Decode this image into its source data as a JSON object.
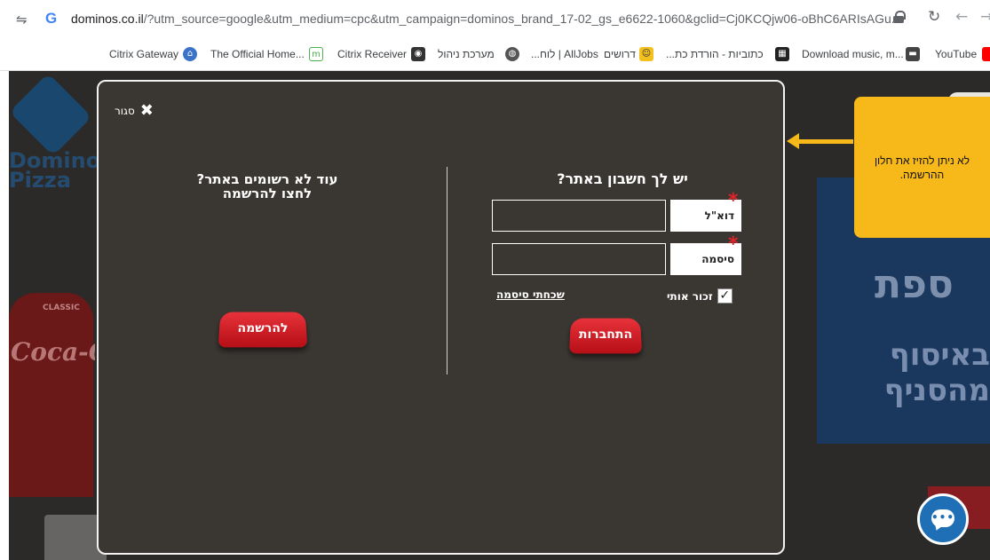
{
  "browser": {
    "url_host": "dominos.co.il",
    "url_rest": "/?utm_source=google&utm_medium=cpc&utm_campaign=dominos_brand_17-02_gs_e6622-1060&gclid=Cj0KCQjw06-oBhC6ARIsAGu...",
    "bookmarks": [
      "Citrix Gateway",
      "The Official Home...",
      "Citrix Receiver",
      "מערכת ניהול",
      "AllJobs | לוח...",
      "דרושים",
      "כתוביות - הורדת כת...",
      "Download music, m...",
      "YouTube"
    ]
  },
  "background": {
    "brand_word": "Domino's Pizza",
    "drink_text": "Coca-Cola",
    "drink_sub": "CLASSIC",
    "promo_line1": "באיסוף",
    "promo_line2": "מהסניף",
    "promo_word": "ספת"
  },
  "modal": {
    "close_label": "סגור",
    "login_title": "יש לך חשבון באתר?",
    "email_label": "דוא\"ל",
    "email_value": "",
    "password_label": "סיסמה",
    "password_value": "",
    "remember_label": "זכור אותי",
    "remember_checked": "✓",
    "forgot_label": "שכחתי סיסמה",
    "login_button": "התחברות",
    "register_title_1": "עוד לא רשומים באתר?",
    "register_title_2": "לחצו להרשמה",
    "register_button": "להרשמה"
  },
  "annotation": {
    "text": "לא ניתן להזיז את חלון ההרשמה."
  },
  "colors": {
    "overlay": "#2c2a28",
    "modal_bg": "#3a3632",
    "button_red": "#d0202a",
    "note_yellow": "#f7b919",
    "chat_blue": "#1f6fb7"
  },
  "icons": {
    "back": "arrow-left-icon",
    "reload": "reload-icon",
    "close": "close-x-icon",
    "chat": "chat-bubble-icon"
  }
}
